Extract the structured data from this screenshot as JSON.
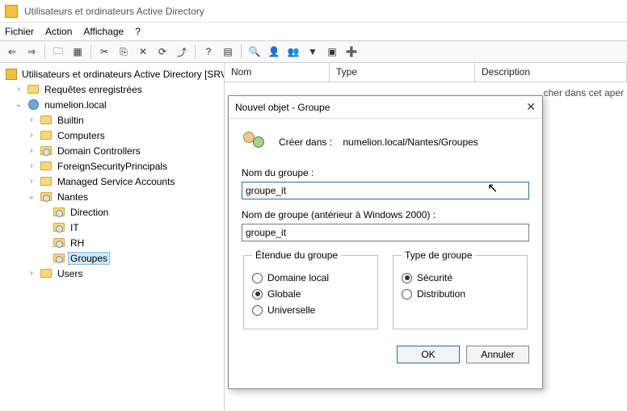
{
  "window": {
    "title": "Utilisateurs et ordinateurs Active Directory"
  },
  "menu": {
    "file": "Fichier",
    "action": "Action",
    "view": "Affichage",
    "help": "?"
  },
  "tree": {
    "root": "Utilisateurs et ordinateurs Active Directory [SRV-A",
    "saved": "Requêtes enregistrées",
    "domain": "numelion.local",
    "builtin": "Builtin",
    "computers": "Computers",
    "dc": "Domain Controllers",
    "fsp": "ForeignSecurityPrincipals",
    "msa": "Managed Service Accounts",
    "nantes": "Nantes",
    "direction": "Direction",
    "it": "IT",
    "rh": "RH",
    "groupes": "Groupes",
    "users": "Users"
  },
  "columns": {
    "nom": "Nom",
    "type": "Type",
    "desc": "Description"
  },
  "hint": "cher dans cet aper",
  "dialog": {
    "title": "Nouvel objet - Groupe",
    "create_in_label": "Créer dans :",
    "create_in_path": "numelion.local/Nantes/Groupes",
    "name_label": "Nom du groupe :",
    "name_value": "groupe_it",
    "name2000_label": "Nom de groupe (antérieur à Windows 2000) :",
    "name2000_value": "groupe_it",
    "scope_legend": "Étendue du groupe",
    "scope_local": "Domaine local",
    "scope_global": "Globale",
    "scope_univ": "Universelle",
    "type_legend": "Type de groupe",
    "type_security": "Sécurité",
    "type_distribution": "Distribution",
    "ok": "OK",
    "cancel": "Annuler"
  }
}
